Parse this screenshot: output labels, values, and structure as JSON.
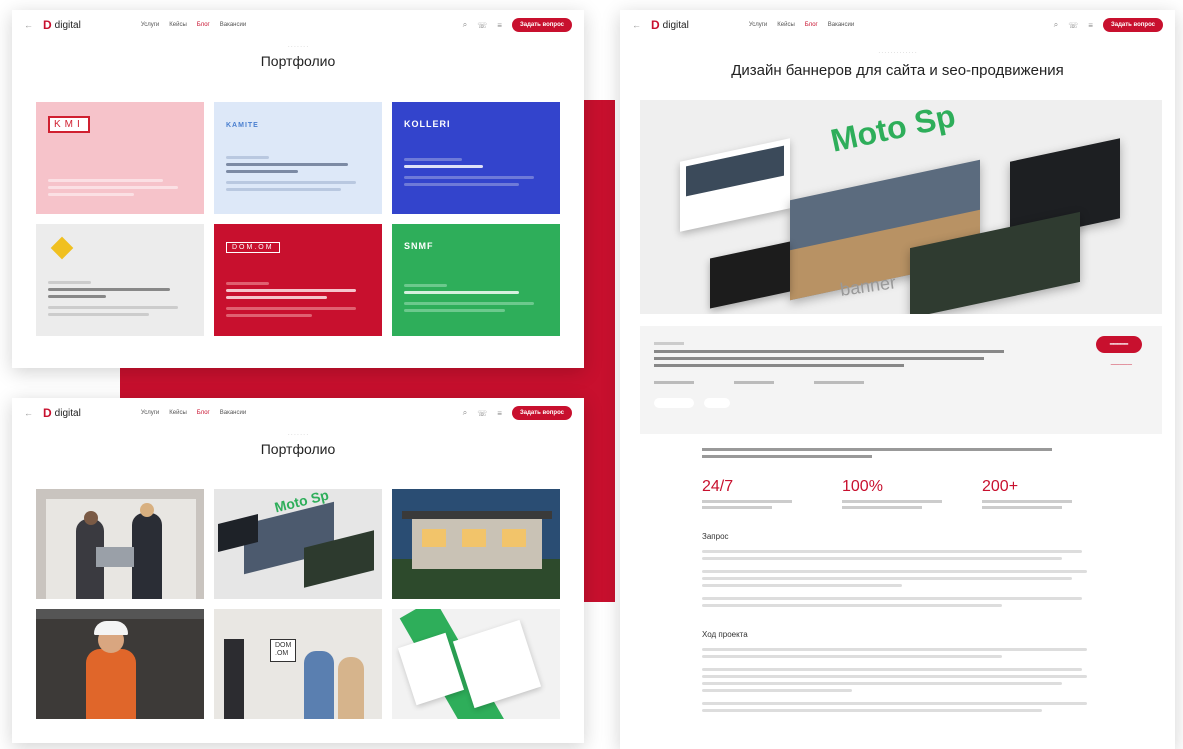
{
  "nav": {
    "brand": "digital",
    "menu": [
      "Услуги",
      "Кейсы",
      "Блог",
      "Вакансии"
    ],
    "active_index": 2,
    "cta": "Задать вопрос"
  },
  "portfolio": {
    "title": "Портфолио"
  },
  "tiles": [
    {
      "logo": "KMI",
      "bg": "#f6c3ca"
    },
    {
      "logo": "KAMITE",
      "bg": "#dde8f8"
    },
    {
      "logo": "KOLLERI",
      "bg": "#3344cc"
    },
    {
      "logo": "",
      "bg": "#ececec"
    },
    {
      "logo": "DOM.OM",
      "bg": "#c8102e"
    },
    {
      "logo": "SNMF",
      "bg": "#2eae5a"
    }
  ],
  "article": {
    "title": "Дизайн баннеров для сайта и seo-продвижения",
    "hero_text": "Moto Sp",
    "hero_sub": "banner",
    "stats": [
      {
        "value": "24/7"
      },
      {
        "value": "100%"
      },
      {
        "value": "200+"
      }
    ],
    "headings": [
      "Запрос",
      "Ход проекта"
    ]
  },
  "colors": {
    "accent": "#c8102e",
    "page": "#ffffff",
    "hero_bg": "#efefef"
  }
}
